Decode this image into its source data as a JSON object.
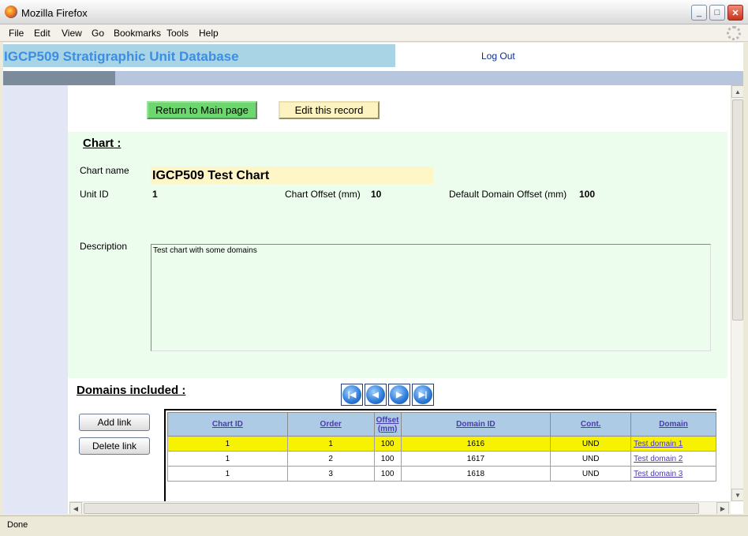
{
  "window": {
    "title": "Mozilla Firefox",
    "minimize": "_",
    "maximize": "□",
    "close": "✕"
  },
  "menu": [
    "File",
    "Edit",
    "View",
    "Go",
    "Bookmarks",
    "Tools",
    "Help"
  ],
  "header": {
    "app_title": "IGCP509 Stratigraphic Unit Database",
    "logout": "Log Out"
  },
  "buttons": {
    "return_main": "Return to Main page",
    "edit_record": "Edit this record",
    "add_link": "Add link",
    "delete_link": "Delete link"
  },
  "chart": {
    "section_title": "Chart :",
    "name_label": "Chart name",
    "name_value": "IGCP509 Test Chart",
    "unit_id_label": "Unit ID",
    "unit_id_value": "1",
    "offset_label": "Chart Offset (mm)",
    "offset_value": "10",
    "domain_offset_label": "Default Domain Offset (mm)",
    "domain_offset_value": "100",
    "description_label": "Description",
    "description_value": "Test chart with some domains"
  },
  "domains": {
    "section_title": "Domains included :",
    "nav_icons": [
      "first-record-icon",
      "previous-record-icon",
      "next-record-icon",
      "last-record-icon"
    ],
    "columns": [
      "Chart ID",
      "Order",
      "Offset (mm)",
      "Domain ID",
      "Cont.",
      "Domain"
    ],
    "rows": [
      {
        "chart_id": "1",
        "order": "1",
        "offset": "100",
        "domain_id": "1616",
        "cont": "UND",
        "domain": "Test domain 1",
        "highlight": true
      },
      {
        "chart_id": "1",
        "order": "2",
        "offset": "100",
        "domain_id": "1617",
        "cont": "UND",
        "domain": "Test domain 2",
        "highlight": false
      },
      {
        "chart_id": "1",
        "order": "3",
        "offset": "100",
        "domain_id": "1618",
        "cont": "UND",
        "domain": "Test domain 3",
        "highlight": false
      }
    ]
  },
  "status": {
    "text": "Done"
  },
  "colors": {
    "header_band": "#a8d4e6",
    "panel": "#ecfced",
    "highlight_row": "#f7f200",
    "main_button": "#6ed66e",
    "edit_button": "#fdf3c1"
  }
}
